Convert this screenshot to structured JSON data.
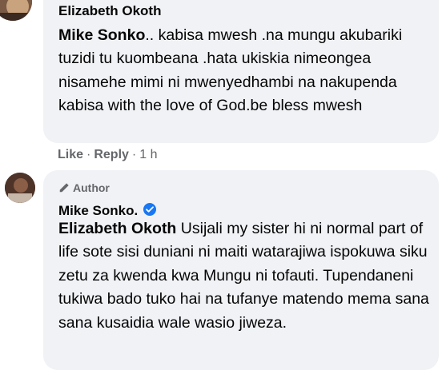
{
  "comment1": {
    "author": "Elizabeth Okoth",
    "mention": "Mike Sonko",
    "text": ".. kabisa mwesh .na mungu akubariki tuzidi tu kuombeana .hata ukiskia nimeongea nisamehe mimi ni mwenyedhambi na nakupenda kabisa with the love of God.be bless mwesh",
    "actions": {
      "like": "Like",
      "reply": "Reply",
      "separator": "·",
      "time": "1 h"
    }
  },
  "comment2": {
    "badge": "Author",
    "author": "Mike Sonko.",
    "mention": "Elizabeth Okoth",
    "text": " Usijali my sister hi ni normal part of life sote sisi duniani ni maiti watarajiwa ispokuwa siku zetu za kwenda kwa Mungu ni tofauti. Tupendaneni tukiwa bado tuko hai na tufanye matendo mema sana sana kusaidia wale wasio jiweza."
  },
  "colors": {
    "bubble": "#f0f2f5",
    "text": "#050505",
    "meta": "#65676b",
    "verified": "#1877f2"
  }
}
